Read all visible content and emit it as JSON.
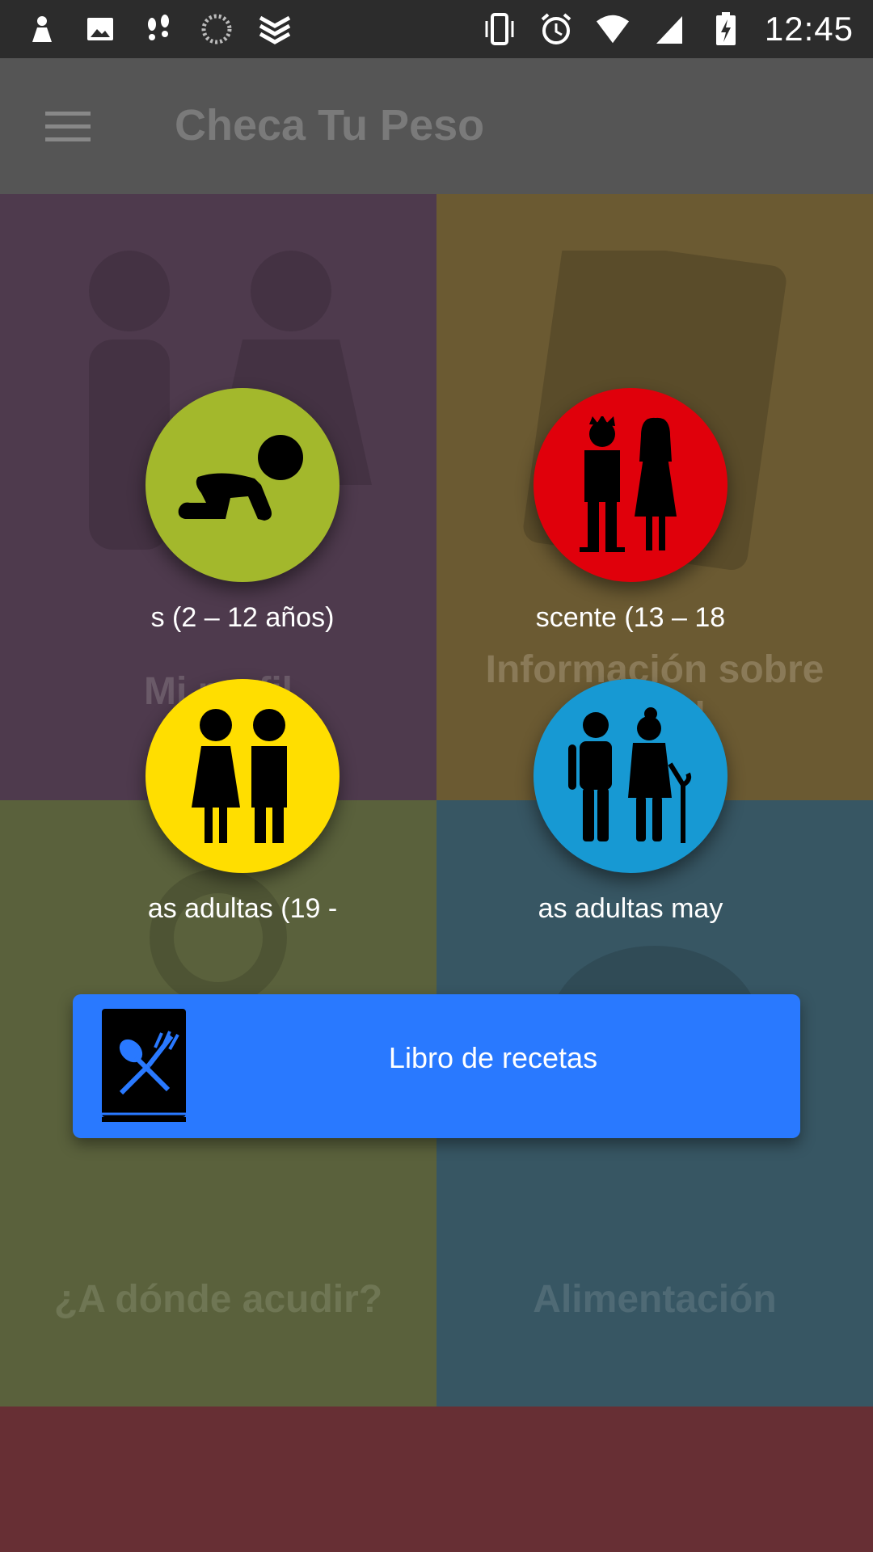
{
  "status_bar": {
    "time": "12:45",
    "left_icons": [
      "notification-icon-1",
      "gallery-icon",
      "steps-icon",
      "loading-icon",
      "layers-icon"
    ],
    "right_icons": [
      "vibrate-icon",
      "alarm-icon",
      "wifi-icon",
      "signal-icon",
      "battery-charging-icon"
    ]
  },
  "app_bar": {
    "title": "Checa Tu Peso",
    "menu_icon": "hamburger-menu-icon"
  },
  "tiles": [
    {
      "label": "Mi perfil",
      "color": "#4e3a4d"
    },
    {
      "label": "Información sobre salud",
      "color": "#6b5a32"
    },
    {
      "label": "¿A dónde acudir?",
      "color": "#5a613c"
    },
    {
      "label": "Alimentación",
      "color": "#375663"
    }
  ],
  "age_groups": [
    {
      "label": "s (2 – 12 años)",
      "color": "#a3b82c",
      "icon": "baby-crawling-icon"
    },
    {
      "label": "scente (13 – 18",
      "color": "#e0000b",
      "icon": "teenagers-icon"
    },
    {
      "label": "as adultas (19 -",
      "color": "#ffde00",
      "icon": "adults-icon"
    },
    {
      "label": "as adultas may",
      "color": "#1799d3",
      "icon": "seniors-icon"
    }
  ],
  "recipe_button": {
    "label": "Libro de recetas",
    "icon": "recipe-book-icon",
    "color": "#2979ff"
  }
}
